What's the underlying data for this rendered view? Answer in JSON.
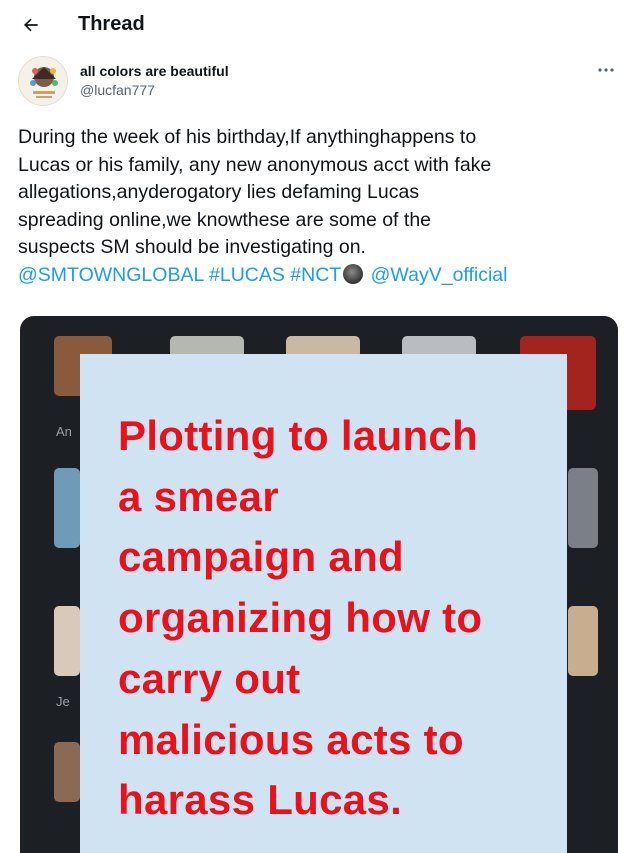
{
  "header": {
    "title": "Thread"
  },
  "author": {
    "display_name": "all colors are beautiful",
    "handle": "@lucfan777"
  },
  "tweet": {
    "lines": [
      "During the week of his birthday,If anythinghappens to",
      "Lucas or his family, any new anonymous acct with fake",
      "allegations,anyderogatory lies defaming Lucas",
      "spreading online,we knowthese are some of the",
      "suspects SM should be investigating on."
    ],
    "mention_smtown": "@SMTOWNGLOBAL",
    "hashtag_lucas": "#LUCAS",
    "hashtag_nct": "#NCT",
    "mention_wayv": "@WayV_official"
  },
  "media": {
    "side_labels": [
      "An",
      "Je"
    ],
    "overlay_lines": [
      "Plotting to launch",
      "a smear",
      "campaign and",
      "organizing how to",
      "carry out",
      "malicious acts to",
      "harass Lucas."
    ]
  },
  "colors": {
    "link": "#1d9bf0",
    "overlay_bg": "#cfe3f2",
    "overlay_text": "#e8121c",
    "media_bg": "#1c1f24"
  },
  "icons": [
    "back-arrow-icon",
    "more-options-icon",
    "nct-emoji-icon"
  ]
}
